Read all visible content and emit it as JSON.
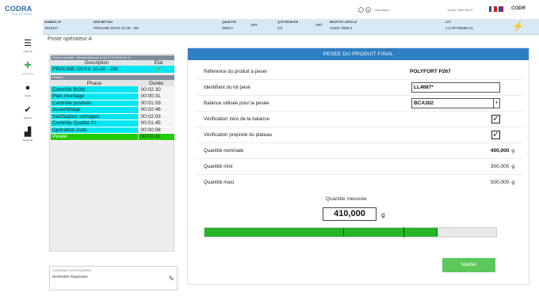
{
  "app": {
    "logo": "CODRA",
    "logo_sub": "SOLUTIONS",
    "user": "Opérateur",
    "date": "10 juil. 2020 09:07",
    "brand": "CODR"
  },
  "info": [
    {
      "label": "NUMERO OF",
      "value": "7019127"
    },
    {
      "label": "DESCRIPTION",
      "value": "PROLINE ONYX 10-30 - 2M"
    },
    {
      "label": "QUANTITE",
      "value": "2500.0"
    },
    {
      "label": "",
      "value": "ART"
    },
    {
      "label": "QTE PRODUITE",
      "value": "0.0"
    },
    {
      "label": "",
      "value": "ART"
    },
    {
      "label": "RECETTE / ARTICLE",
      "value": "Article Y595-2"
    },
    {
      "label": "LOT",
      "value": "1.2   OF755054-11"
    }
  ],
  "sidebar": {
    "items": [
      {
        "label": "Liste OF",
        "icon": "list-icon"
      },
      {
        "label": "Opérations",
        "icon": "plus-icon"
      },
      {
        "label": "Arrêts",
        "icon": "stop-icon"
      },
      {
        "label": "Rebuts",
        "icon": "scrap-icon"
      },
      {
        "label": "Rapports",
        "icon": "chart-icon"
      }
    ]
  },
  "page_title": "Poste opérateur A",
  "left": {
    "header": "Fiches à exécuter - Mesurée/Mesurée du 10.07.20 00:00 (Es 1)",
    "col_description": "Description",
    "col_state": "Etat",
    "product_name": "PROLINE ONYX 10-30 - 2M",
    "product_state": "★",
    "phases_header": "Phases",
    "col_phase": "Phase",
    "col_duration": "Durée",
    "phases": [
      {
        "name": "Contrôle BOM",
        "duration": "00:02:30",
        "status": "done"
      },
      {
        "name": "Plan montage",
        "duration": "00:00:31",
        "status": "done"
      },
      {
        "name": "Contrôle position",
        "duration": "00:01:09",
        "status": "done"
      },
      {
        "name": "Assemblage",
        "duration": "00:02:46",
        "status": "done"
      },
      {
        "name": "Vérification serrages",
        "duration": "00:02:03",
        "status": "done"
      },
      {
        "name": "Contrôle Qualité 01",
        "duration": "00:01:45",
        "status": "done"
      },
      {
        "name": "Opération Auto",
        "duration": "00:00:08",
        "status": "done"
      },
      {
        "name": "Pesée",
        "duration": "00:01:31",
        "status": "current"
      }
    ]
  },
  "consignes": {
    "label": "CONSIGNES INTER EQUIPES",
    "value": "WARNING Réparation"
  },
  "panel": {
    "title": "PESEE DU PRODUIT FINAL",
    "ref_label": "Référence du produit à peser",
    "ref_value": "POLYFORT P267",
    "lot_label": "Identifiant du lot pesé",
    "lot_value": "LL4687*",
    "balance_label": "Balance utilisée pour la pesée",
    "balance_value": "BCA302",
    "zero_label": "Vérification zéro de la balance",
    "zero_checked": true,
    "clean_label": "Vérification propreté du plateau",
    "clean_checked": true,
    "nominal_label": "Quantité nominale",
    "nominal_value": "400,000",
    "min_label": "Quantité mini",
    "min_value": "300,000",
    "max_label": "Quantité maxi",
    "max_value": "500,000",
    "unit": "g",
    "measured_label": "Quantité mesurée",
    "measured_value": "410,000",
    "measured_unit": "g",
    "gauge": {
      "min": 0,
      "max": 600,
      "tol_low": 300,
      "tol_high": 500,
      "measured": 410
    },
    "validate_label": "Valider"
  },
  "colors": {
    "header_blue": "#2e7ec4",
    "done_cyan": "#00e5f0",
    "current_green": "#22cc00",
    "button_green": "#5cc85c"
  }
}
